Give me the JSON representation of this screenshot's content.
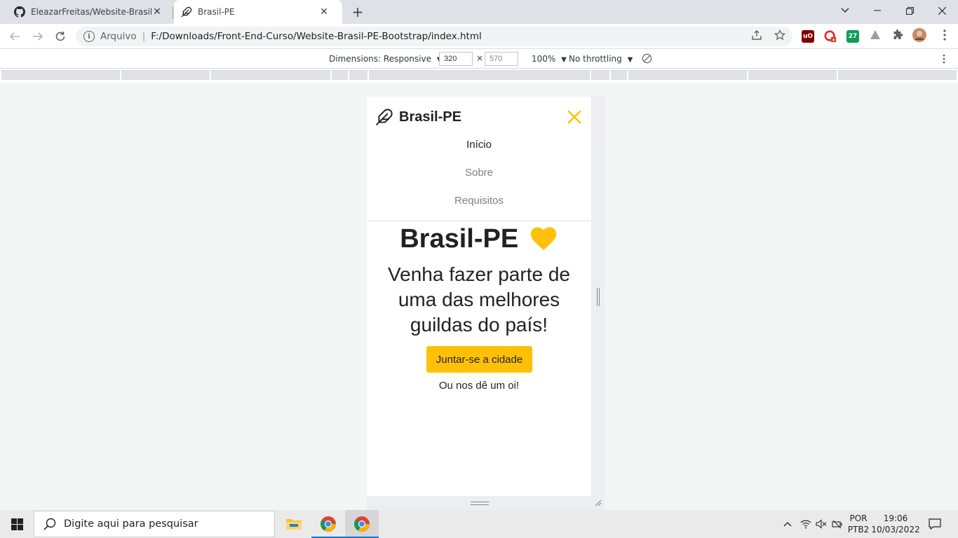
{
  "browser": {
    "tabs": [
      {
        "title": "EleazarFreitas/Website-Brasil-PE-",
        "icon": "github-icon",
        "active": false
      },
      {
        "title": "Brasil-PE",
        "icon": "feather-icon",
        "active": true
      }
    ],
    "address": {
      "scheme_label": "Arquivo",
      "url": "F:/Downloads/Front-End-Curso/Website-Brasil-PE-Bootstrap/index.html"
    },
    "extensions": [
      {
        "name": "ublock-icon",
        "color": "#800000",
        "label": "uO"
      },
      {
        "name": "record-extension-icon",
        "color": "#e52d27",
        "label": ""
      },
      {
        "name": "calendar-extension-icon",
        "color": "#0f9d58",
        "label": "27"
      }
    ]
  },
  "devtools": {
    "dimensions_label": "Dimensions: Responsive",
    "width": "320",
    "height": "570",
    "times": "×",
    "zoom": "100%",
    "throttling": "No throttling"
  },
  "site": {
    "brand": "Brasil-PE",
    "nav": [
      {
        "label": "Início",
        "active": true
      },
      {
        "label": "Sobre",
        "active": false
      },
      {
        "label": "Requisitos",
        "active": false
      }
    ],
    "hero_title": "Brasil-PE",
    "hero_subtitle": "Venha fazer parte de uma das melhores guildas do país!",
    "cta_label": "Juntar-se a cidade",
    "secondary_link": "Ou nos dê um oi!",
    "accent_color": "#ffc107"
  },
  "taskbar": {
    "search_placeholder": "Digite aqui para pesquisar",
    "language": "POR",
    "keyboard": "PTB2",
    "time": "19:06",
    "date": "10/03/2022"
  }
}
